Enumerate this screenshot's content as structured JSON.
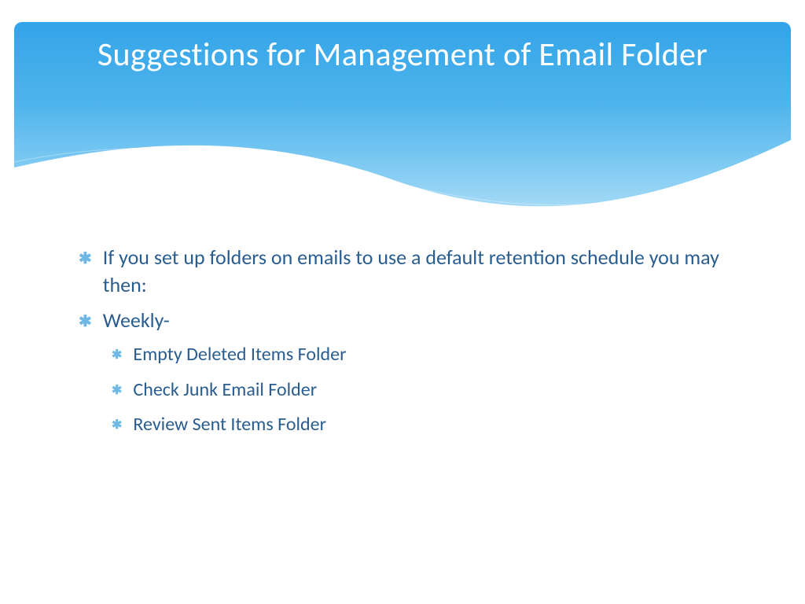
{
  "slide": {
    "title": "Suggestions for Management of Email Folder",
    "bullets": [
      {
        "level": 1,
        "text": "If you set up folders on emails to use a default retention schedule you may then:"
      },
      {
        "level": 1,
        "text": "Weekly-"
      },
      {
        "level": 2,
        "text": "Empty Deleted Items Folder"
      },
      {
        "level": 2,
        "text": "Check Junk Email Folder"
      },
      {
        "level": 2,
        "text": "Review Sent Items Folder"
      }
    ]
  },
  "colors": {
    "title_text": "#ffffff",
    "body_text": "#2a5d8f",
    "bullet_icon": "#6fb8e6",
    "banner_top": "#33a4e8",
    "banner_bottom": "#b5e0f8"
  }
}
